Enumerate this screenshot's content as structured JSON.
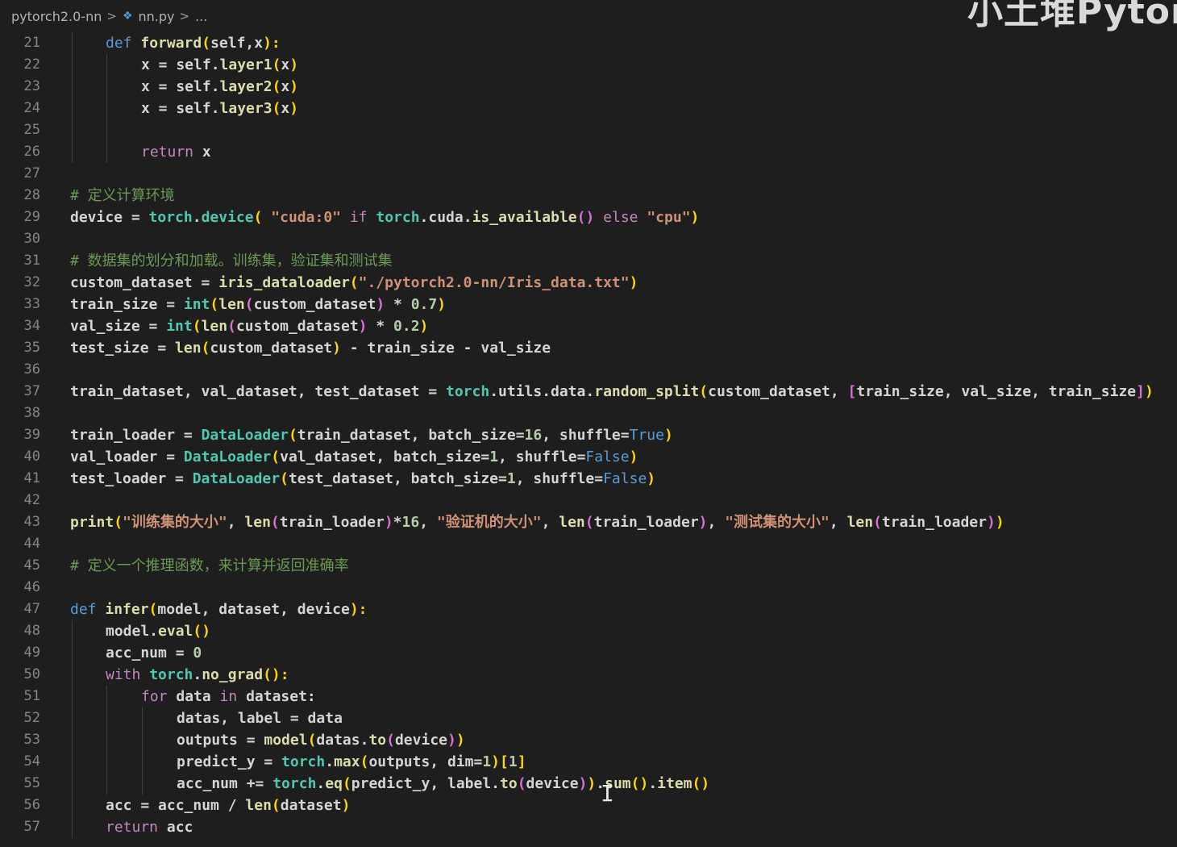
{
  "breadcrumb": {
    "folder": "pytorch2.0-nn",
    "file": "nn.py",
    "ellipsis": "...",
    "separator": ">",
    "file_icon": "python-file-icon"
  },
  "watermark": "小土堆Pytor",
  "colors": {
    "background": "#1e1e1e",
    "keyword": "#569cd6",
    "control": "#c586c0",
    "function": "#dcdcaa",
    "module": "#4ec9b0",
    "string": "#ce9178",
    "number": "#b5cea8",
    "comment": "#6a9955"
  },
  "lines": [
    {
      "n": "21",
      "indent": 1,
      "tokens": [
        [
          "kw",
          "def "
        ],
        [
          "fn",
          "forward"
        ],
        [
          "br1",
          "("
        ],
        [
          "var",
          "self,x"
        ],
        [
          "br1",
          "):"
        ]
      ]
    },
    {
      "n": "22",
      "indent": 2,
      "tokens": [
        [
          "var",
          "x = self."
        ],
        [
          "fn",
          "layer1"
        ],
        [
          "br1",
          "("
        ],
        [
          "var",
          "x"
        ],
        [
          "br1",
          ")"
        ]
      ]
    },
    {
      "n": "23",
      "indent": 2,
      "tokens": [
        [
          "var",
          "x = self."
        ],
        [
          "fn",
          "layer2"
        ],
        [
          "br1",
          "("
        ],
        [
          "var",
          "x"
        ],
        [
          "br1",
          ")"
        ]
      ]
    },
    {
      "n": "24",
      "indent": 2,
      "tokens": [
        [
          "var",
          "x = self."
        ],
        [
          "fn",
          "layer3"
        ],
        [
          "br1",
          "("
        ],
        [
          "var",
          "x"
        ],
        [
          "br1",
          ")"
        ]
      ]
    },
    {
      "n": "25",
      "indent": 0,
      "tokens": []
    },
    {
      "n": "26",
      "indent": 2,
      "tokens": [
        [
          "ctl",
          "return "
        ],
        [
          "var",
          "x"
        ]
      ]
    },
    {
      "n": "27",
      "indent": 0,
      "tokens": []
    },
    {
      "n": "28",
      "indent": 0,
      "tokens": [
        [
          "cmt",
          "# 定义计算环境"
        ]
      ]
    },
    {
      "n": "29",
      "indent": 0,
      "tokens": [
        [
          "var",
          "device = "
        ],
        [
          "mod",
          "torch"
        ],
        [
          "var",
          "."
        ],
        [
          "mod",
          "device"
        ],
        [
          "br1",
          "( "
        ],
        [
          "str",
          "\"cuda:0\""
        ],
        [
          "ctl",
          " if "
        ],
        [
          "mod",
          "torch"
        ],
        [
          "var",
          ".cuda."
        ],
        [
          "fn",
          "is_available"
        ],
        [
          "br2",
          "()"
        ],
        [
          "ctl",
          " else "
        ],
        [
          "str",
          "\"cpu\""
        ],
        [
          "br1",
          ")"
        ]
      ]
    },
    {
      "n": "30",
      "indent": 0,
      "tokens": []
    },
    {
      "n": "31",
      "indent": 0,
      "tokens": [
        [
          "cmt",
          "# 数据集的划分和加载。训练集，验证集和测试集"
        ]
      ]
    },
    {
      "n": "32",
      "indent": 0,
      "tokens": [
        [
          "var",
          "custom_dataset = "
        ],
        [
          "fn",
          "iris_dataloader"
        ],
        [
          "br1",
          "("
        ],
        [
          "str",
          "\"./pytorch2.0-nn/Iris_data.txt\""
        ],
        [
          "br1",
          ")"
        ]
      ]
    },
    {
      "n": "33",
      "indent": 0,
      "tokens": [
        [
          "var",
          "train_size = "
        ],
        [
          "mod",
          "int"
        ],
        [
          "br1",
          "("
        ],
        [
          "fn",
          "len"
        ],
        [
          "br2",
          "("
        ],
        [
          "var",
          "custom_dataset"
        ],
        [
          "br2",
          ")"
        ],
        [
          "var",
          " * "
        ],
        [
          "num",
          "0.7"
        ],
        [
          "br1",
          ")"
        ]
      ]
    },
    {
      "n": "34",
      "indent": 0,
      "tokens": [
        [
          "var",
          "val_size = "
        ],
        [
          "mod",
          "int"
        ],
        [
          "br1",
          "("
        ],
        [
          "fn",
          "len"
        ],
        [
          "br2",
          "("
        ],
        [
          "var",
          "custom_dataset"
        ],
        [
          "br2",
          ")"
        ],
        [
          "var",
          " * "
        ],
        [
          "num",
          "0.2"
        ],
        [
          "br1",
          ")"
        ]
      ]
    },
    {
      "n": "35",
      "indent": 0,
      "tokens": [
        [
          "var",
          "test_size = "
        ],
        [
          "fn",
          "len"
        ],
        [
          "br1",
          "("
        ],
        [
          "var",
          "custom_dataset"
        ],
        [
          "br1",
          ")"
        ],
        [
          "var",
          " - train_size - val_size"
        ]
      ]
    },
    {
      "n": "36",
      "indent": 0,
      "tokens": []
    },
    {
      "n": "37",
      "indent": 0,
      "tokens": [
        [
          "var",
          "train_dataset, val_dataset, test_dataset = "
        ],
        [
          "mod",
          "torch"
        ],
        [
          "var",
          ".utils.data."
        ],
        [
          "fn",
          "random_split"
        ],
        [
          "br1",
          "("
        ],
        [
          "var",
          "custom_dataset, "
        ],
        [
          "br2",
          "["
        ],
        [
          "var",
          "train_size, val_size, train_size"
        ],
        [
          "br2",
          "]"
        ],
        [
          "br1",
          ")"
        ]
      ]
    },
    {
      "n": "38",
      "indent": 0,
      "tokens": []
    },
    {
      "n": "39",
      "indent": 0,
      "tokens": [
        [
          "var",
          "train_loader = "
        ],
        [
          "mod",
          "DataLoader"
        ],
        [
          "br1",
          "("
        ],
        [
          "var",
          "train_dataset, batch_size="
        ],
        [
          "num",
          "16"
        ],
        [
          "var",
          ", shuffle="
        ],
        [
          "const",
          "True"
        ],
        [
          "br1",
          ")"
        ]
      ]
    },
    {
      "n": "40",
      "indent": 0,
      "tokens": [
        [
          "var",
          "val_loader = "
        ],
        [
          "mod",
          "DataLoader"
        ],
        [
          "br1",
          "("
        ],
        [
          "var",
          "val_dataset, batch_size="
        ],
        [
          "num",
          "1"
        ],
        [
          "var",
          ", shuffle="
        ],
        [
          "const",
          "False"
        ],
        [
          "br1",
          ")"
        ]
      ]
    },
    {
      "n": "41",
      "indent": 0,
      "tokens": [
        [
          "var",
          "test_loader = "
        ],
        [
          "mod",
          "DataLoader"
        ],
        [
          "br1",
          "("
        ],
        [
          "var",
          "test_dataset, batch_size="
        ],
        [
          "num",
          "1"
        ],
        [
          "var",
          ", shuffle="
        ],
        [
          "const",
          "False"
        ],
        [
          "br1",
          ")"
        ]
      ]
    },
    {
      "n": "42",
      "indent": 0,
      "tokens": []
    },
    {
      "n": "43",
      "indent": 0,
      "tokens": [
        [
          "fn",
          "print"
        ],
        [
          "br1",
          "("
        ],
        [
          "str",
          "\"训练集的大小\""
        ],
        [
          "var",
          ", "
        ],
        [
          "fn",
          "len"
        ],
        [
          "br2",
          "("
        ],
        [
          "var",
          "train_loader"
        ],
        [
          "br2",
          ")"
        ],
        [
          "var",
          "*"
        ],
        [
          "num",
          "16"
        ],
        [
          "var",
          ", "
        ],
        [
          "str",
          "\"验证机的大小\""
        ],
        [
          "var",
          ", "
        ],
        [
          "fn",
          "len"
        ],
        [
          "br2",
          "("
        ],
        [
          "var",
          "train_loader"
        ],
        [
          "br2",
          ")"
        ],
        [
          "var",
          ", "
        ],
        [
          "str",
          "\"测试集的大小\""
        ],
        [
          "var",
          ", "
        ],
        [
          "fn",
          "len"
        ],
        [
          "br2",
          "("
        ],
        [
          "var",
          "train_loader"
        ],
        [
          "br2",
          ")"
        ],
        [
          "br1",
          ")"
        ]
      ]
    },
    {
      "n": "44",
      "indent": 0,
      "tokens": []
    },
    {
      "n": "45",
      "indent": 0,
      "tokens": [
        [
          "cmt",
          "# 定义一个推理函数，来计算并返回准确率"
        ]
      ]
    },
    {
      "n": "46",
      "indent": 0,
      "tokens": []
    },
    {
      "n": "47",
      "indent": 0,
      "tokens": [
        [
          "kw",
          "def "
        ],
        [
          "fn",
          "infer"
        ],
        [
          "br1",
          "("
        ],
        [
          "var",
          "model, dataset, device"
        ],
        [
          "br1",
          "):"
        ]
      ]
    },
    {
      "n": "48",
      "indent": 1,
      "tokens": [
        [
          "var",
          "model."
        ],
        [
          "fn",
          "eval"
        ],
        [
          "br1",
          "()"
        ]
      ]
    },
    {
      "n": "49",
      "indent": 1,
      "tokens": [
        [
          "var",
          "acc_num = "
        ],
        [
          "num",
          "0"
        ]
      ]
    },
    {
      "n": "50",
      "indent": 1,
      "tokens": [
        [
          "ctl",
          "with "
        ],
        [
          "mod",
          "torch"
        ],
        [
          "var",
          "."
        ],
        [
          "fn",
          "no_grad"
        ],
        [
          "br1",
          "():"
        ]
      ]
    },
    {
      "n": "51",
      "indent": 2,
      "tokens": [
        [
          "ctl",
          "for "
        ],
        [
          "var",
          "data"
        ],
        [
          "ctl",
          " in "
        ],
        [
          "var",
          "dataset:"
        ]
      ]
    },
    {
      "n": "52",
      "indent": 3,
      "tokens": [
        [
          "var",
          "datas, label = data"
        ]
      ]
    },
    {
      "n": "53",
      "indent": 3,
      "tokens": [
        [
          "var",
          "outputs = "
        ],
        [
          "fn",
          "model"
        ],
        [
          "br1",
          "("
        ],
        [
          "var",
          "datas."
        ],
        [
          "fn",
          "to"
        ],
        [
          "br2",
          "("
        ],
        [
          "var",
          "device"
        ],
        [
          "br2",
          ")"
        ],
        [
          "br1",
          ")"
        ]
      ]
    },
    {
      "n": "54",
      "indent": 3,
      "tokens": [
        [
          "var",
          "predict_y = "
        ],
        [
          "mod",
          "torch"
        ],
        [
          "var",
          "."
        ],
        [
          "fn",
          "max"
        ],
        [
          "br1",
          "("
        ],
        [
          "var",
          "outputs, dim="
        ],
        [
          "num",
          "1"
        ],
        [
          "br1",
          ")"
        ],
        [
          "br1",
          "["
        ],
        [
          "num",
          "1"
        ],
        [
          "br1",
          "]"
        ]
      ]
    },
    {
      "n": "55",
      "indent": 3,
      "tokens": [
        [
          "var",
          "acc_num += "
        ],
        [
          "mod",
          "torch"
        ],
        [
          "var",
          "."
        ],
        [
          "fn",
          "eq"
        ],
        [
          "br1",
          "("
        ],
        [
          "var",
          "predict_y, label."
        ],
        [
          "fn",
          "to"
        ],
        [
          "br2",
          "("
        ],
        [
          "var",
          "device"
        ],
        [
          "br2",
          ")"
        ],
        [
          "br1",
          ")"
        ],
        [
          "var",
          "."
        ],
        [
          "fn",
          "sum"
        ],
        [
          "br1",
          "()"
        ],
        [
          "var",
          "."
        ],
        [
          "fn",
          "item"
        ],
        [
          "br1",
          "()"
        ]
      ]
    },
    {
      "n": "56",
      "indent": 1,
      "tokens": [
        [
          "var",
          "acc = acc_num / "
        ],
        [
          "fn",
          "len"
        ],
        [
          "br1",
          "("
        ],
        [
          "var",
          "dataset"
        ],
        [
          "br1",
          ")"
        ]
      ]
    },
    {
      "n": "57",
      "indent": 1,
      "tokens": [
        [
          "ctl",
          "return "
        ],
        [
          "var",
          "acc"
        ]
      ]
    }
  ]
}
